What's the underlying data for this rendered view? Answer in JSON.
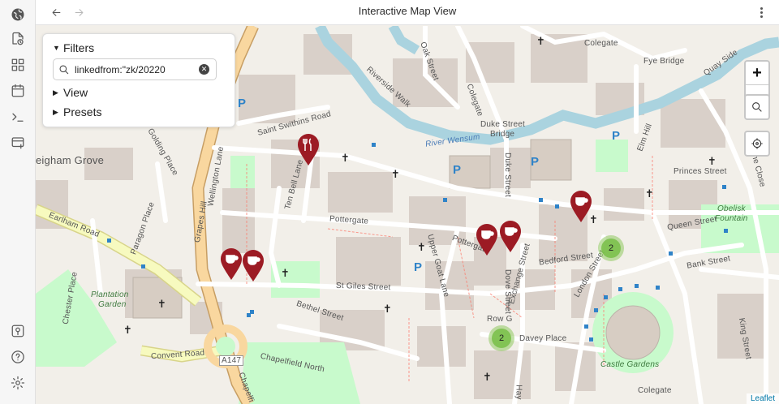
{
  "window": {
    "title": "Interactive Map View"
  },
  "filters": {
    "heading": "Filters",
    "search_value": "linkedfrom:\"zk/20220",
    "view_label": "View",
    "presets_label": "Presets"
  },
  "map_labels": {
    "colegate_top": "Colegate",
    "fye_bridge": "Fye Bridge",
    "quay_side": "Quay Side",
    "oak_street": "Oak Street",
    "riverside_walk": "Riverside Walk",
    "colegate_mid": "Colegate",
    "duke_street_bridge_1": "Duke Street",
    "duke_street_bridge_2": "Bridge",
    "river_wensum": "River Wensum",
    "saint_swithins": "Saint Swithins Road",
    "heigham_grove": "eigham Grove",
    "golding_place": "Golding Place",
    "wellington_lane": "Wellington Lane",
    "ten_bell_lane": "Ten Bell Lane",
    "duke_street": "Duke Street",
    "elm_hill": "Elm Hill",
    "princes_street": "Princes Street",
    "the_close": "The Close",
    "obelisk_fountain_1": "Obelisk",
    "obelisk_fountain_2": "Fountain",
    "queen_street": "Queen Street",
    "bank_street": "Bank Street",
    "earlham_road": "Earlham Road",
    "paragon_place": "Paragon Place",
    "grapes_hill": "Grapes Hill",
    "pottergate": "Pottergate",
    "pottergate_2": "Pottergate",
    "upper_goat_lane": "Upper Goat Lane",
    "bedford_street": "Bedford Street",
    "exchange_street": "Exchange Street",
    "dove_street": "Dove Street",
    "london_street": "London Street",
    "st_giles_street": "St Giles Street",
    "chester_place": "Chester Place",
    "plantation_garden_1": "Plantation",
    "plantation_garden_2": "Garden",
    "bethel_street": "Bethel Street",
    "row_g": "Row G",
    "davey_place": "Davey Place",
    "king_street": "King Street",
    "castle_gardens": "Castle Gardens",
    "convent_road": "Convent Road",
    "a147": "A147",
    "chapelfield_north": "Chapelfield North",
    "chapelfield_east": "Chapelfi",
    "hay": "Hay",
    "colegate_right": "Colegate"
  },
  "clusters": [
    "2",
    "2"
  ],
  "controls": {
    "zoom_in": "+",
    "zoom_out": "−"
  },
  "attribution": "Leaflet",
  "icons": {
    "ribbon": [
      "globe-icon",
      "file-clock-icon",
      "layout-grid-icon",
      "calendar-icon",
      "terminal-icon",
      "list-plus-icon",
      "map-pin-square-icon",
      "help-circle-icon",
      "settings-icon"
    ],
    "poi": [
      "restaurant-pin-icon",
      "cafe-pin-icon"
    ]
  },
  "colors": {
    "pin": "#9c1b24",
    "water": "#aad3df",
    "park": "#c8facc",
    "road_major": "#f8d29a",
    "accent": "#2f83c8"
  }
}
